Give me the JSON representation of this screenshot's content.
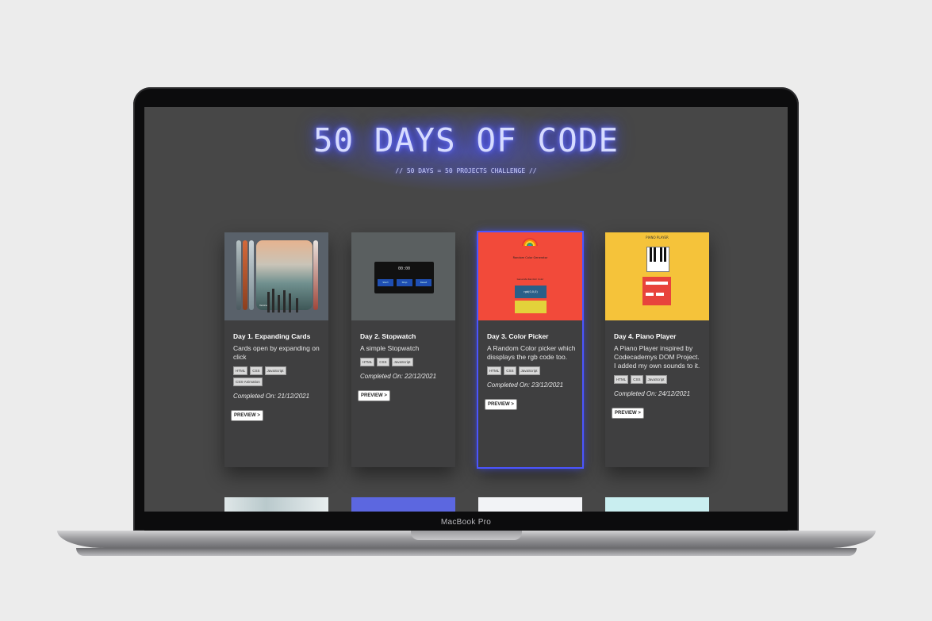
{
  "device": {
    "label": "MacBook Pro"
  },
  "header": {
    "title": "50 DAYS OF CODE",
    "subtitle": "// 50 DAYS = 50 PROJECTS CHALLENGE //"
  },
  "cards": [
    {
      "title": "Day 1. Expanding Cards",
      "description": "Cards open by expanding on click",
      "tags": [
        "HTML",
        "CSS",
        "JavaScript",
        "CSS-Animation"
      ],
      "completed": "Completed On: 21/12/2021",
      "preview": "PREVIEW >",
      "thumb_caption": "Venice"
    },
    {
      "title": "Day 2. Stopwatch",
      "description": "A simple Stopwatch",
      "tags": [
        "HTML",
        "CSS",
        "JavaScript"
      ],
      "completed": "Completed On: 22/12/2021",
      "preview": "PREVIEW >",
      "thumb_time": "00:00",
      "thumb_buttons": [
        "Start",
        "Stop",
        "Reset"
      ]
    },
    {
      "title": "Day 3. Color Picker",
      "description": "A Random Color picker which dissplays the rgb code too.",
      "tags": [
        "HTML",
        "CSS",
        "JavaScript"
      ],
      "completed": "Completed On: 23/12/2021",
      "preview": "PREVIEW >",
      "thumb_title": "Random Color Generator",
      "thumb_sub": "Generate Random Color",
      "thumb_code": "rgb(0,0,0)"
    },
    {
      "title": "Day 4. Piano Player",
      "description": "A Piano Player inspired by Codecademys DOM Project. I added my own sounds to it.",
      "tags": [
        "HTML",
        "CSS",
        "JavaScript"
      ],
      "completed": "Completed On: 24/12/2021",
      "preview": "PREVIEW >",
      "thumb_title": "PIANO PLAYER"
    }
  ],
  "colors": {
    "screen_bg": "#474747",
    "card_bg": "#3f3f40",
    "neon": "#4a52ff",
    "active_outline": "#4b55ff"
  }
}
